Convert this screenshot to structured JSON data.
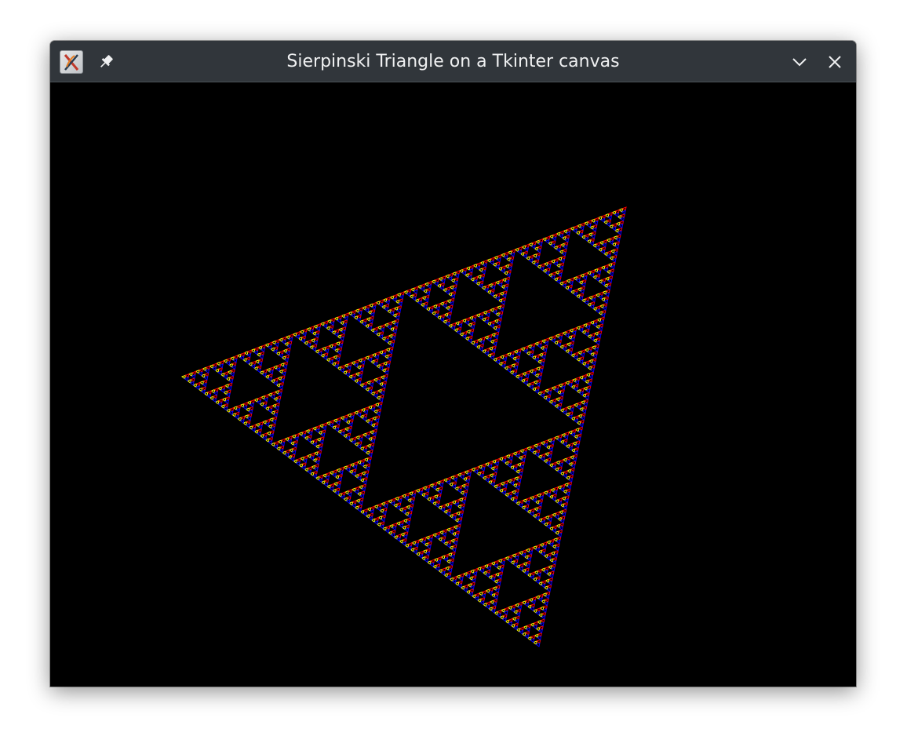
{
  "window": {
    "title": "Sierpinski Triangle on a Tkinter canvas",
    "titlebar_color": "#31363b",
    "title_color": "#eff0f1",
    "icons": {
      "app": "tk-app-icon",
      "pin": "pin-icon",
      "minimize": "chevron-down-icon",
      "close": "close-icon"
    }
  },
  "canvas": {
    "background": "#000000",
    "fractal": {
      "name": "sierpinski-triangle",
      "colors": [
        "#ffff00",
        "#ff0000",
        "#0000ff"
      ]
    }
  }
}
